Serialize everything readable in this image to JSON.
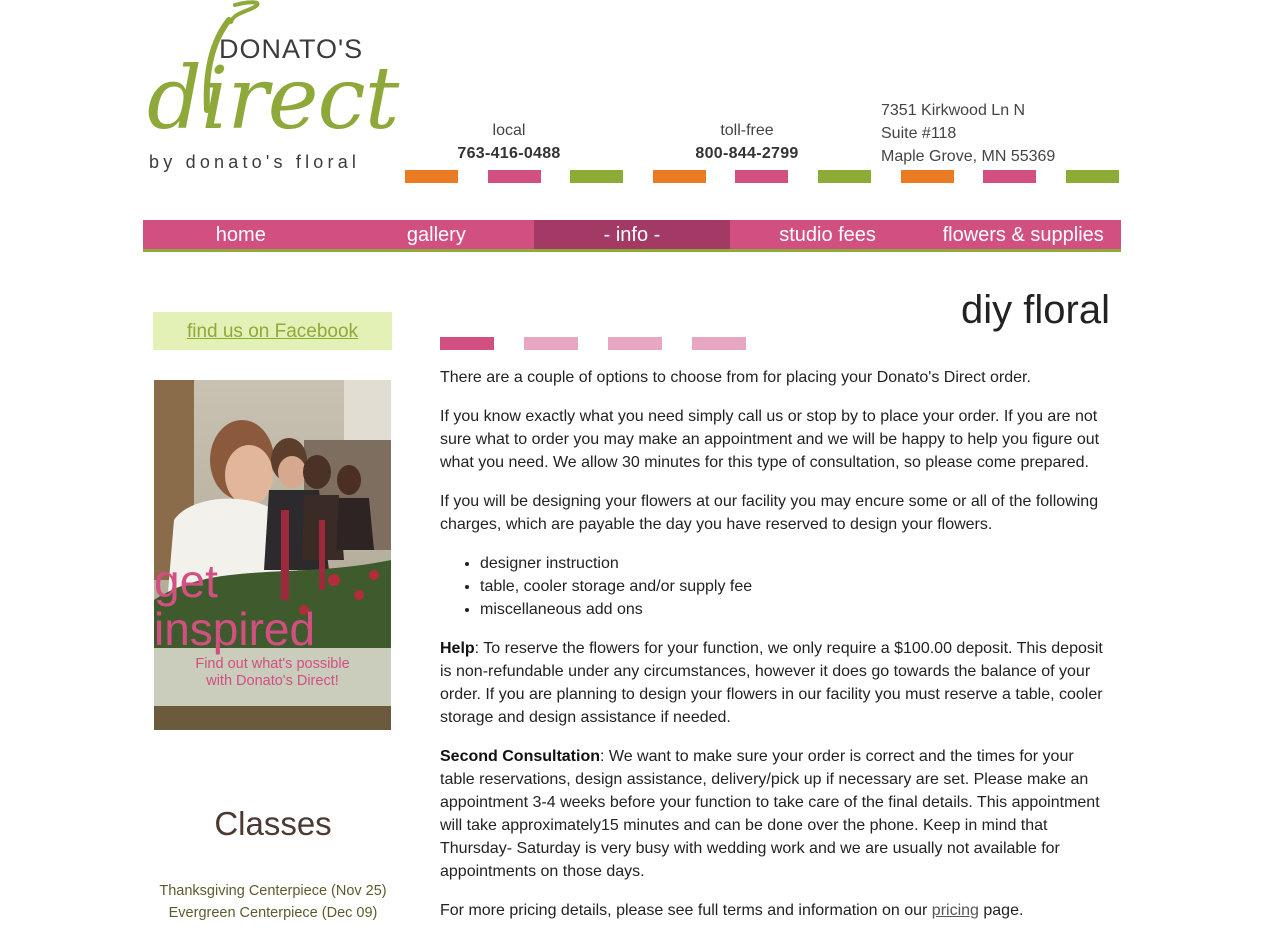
{
  "header": {
    "logo": {
      "top": "DONATO'S",
      "main": "direct",
      "sub": "by donato's floral"
    },
    "local": {
      "label": "local",
      "phone": "763-416-0488"
    },
    "tollfree": {
      "label": "toll-free",
      "phone": "800-844-2799"
    },
    "address": [
      "7351 Kirkwood Ln N",
      "Suite #118",
      "Maple Grove, MN 55369"
    ]
  },
  "colors": {
    "pink": "#d24f81",
    "orange": "#ea7b23",
    "green": "#8eaa37",
    "active_nav": "#a23a65"
  },
  "nav": {
    "items": [
      {
        "label": "home"
      },
      {
        "label": "gallery"
      },
      {
        "label": "- info -",
        "active": true
      },
      {
        "label": "studio fees"
      },
      {
        "label": "flowers & supplies"
      }
    ]
  },
  "sidebar": {
    "facebook_link": "find us on Facebook",
    "promo": {
      "line1": "get",
      "line2": "inspired",
      "caption1": "Find out what's possible",
      "caption2": "with Donato's Direct!"
    },
    "classes_title": "Classes",
    "classes": [
      "Thanksgiving Centerpiece (Nov 25)",
      "Evergreen Centerpiece (Dec 09)"
    ]
  },
  "main": {
    "title": "diy floral",
    "p1": "There are a couple of options to choose from for placing your Donato's Direct order.",
    "p2": "If you know exactly what you need simply call us or stop by to place your order. If you are not sure what to order you may make an appointment and we will be happy to help you figure out what you need. We allow 30 minutes for this type of consultation, so please come prepared.",
    "p3": "If you will be designing your flowers at our facility you may encure some or all of the following charges, which are payable the day you have reserved to design your flowers.",
    "list": [
      "designer instruction",
      "table, cooler storage and/or supply fee",
      "miscellaneous add ons"
    ],
    "help_label": "Help",
    "help_text": ": To reserve the flowers for your function, we only require a $100.00 deposit. This deposit is non-refundable under any circumstances, however it does go towards the balance of your order. If you are planning to design your flowers in our facility you must reserve a table, cooler storage and design assistance if needed.",
    "second_label": "Second Consultation",
    "second_text": ": We want to make sure your order is correct and the times for your table reservations, design assistance, delivery/pick up if necessary are set. Please make an appointment 3-4 weeks before your function to take care of the final details. This appointment will take approximately15 minutes and can be done over the phone. Keep in mind that Thursday- Saturday is very busy with wedding work and we are usually not available for appointments on those days.",
    "pricing_prefix": "For more pricing details, please see full terms and information on our ",
    "pricing_link": "pricing",
    "pricing_suffix": " page."
  }
}
